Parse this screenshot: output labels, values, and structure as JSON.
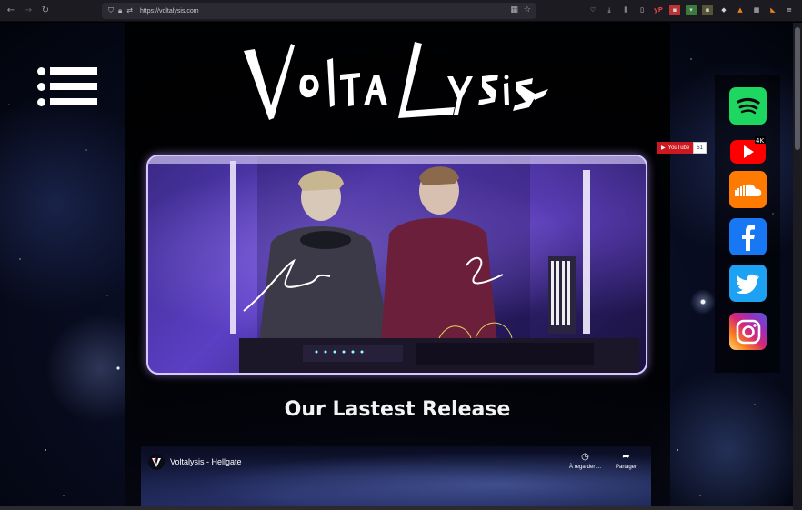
{
  "browser": {
    "url": "https://voltalysis.com",
    "back_icon": "←",
    "forward_icon": "→",
    "reload_icon": "↻",
    "toolbar_icons": [
      "pocket",
      "download",
      "library",
      "sidebar",
      "yp",
      "ext-red",
      "ext-green",
      "ext-10",
      "ext-mask",
      "ext-fox",
      "ext-grid",
      "ext-fox2",
      "menu"
    ]
  },
  "site": {
    "logo_text": "VoltaLysis",
    "release_heading": "Our Lastest Release",
    "youtube_badge": {
      "label": "YouTube",
      "count": "51"
    },
    "video": {
      "title": "Voltalysis - Hellgate",
      "watch_later": "À regarder ...",
      "share": "Partager"
    },
    "social": [
      {
        "name": "spotify",
        "color": "#1ed760"
      },
      {
        "name": "youtube",
        "color": "#ff0000"
      },
      {
        "name": "soundcloud",
        "color": "#ff7700"
      },
      {
        "name": "facebook",
        "color": "#1877f2"
      },
      {
        "name": "twitter",
        "color": "#1da1f2"
      },
      {
        "name": "instagram",
        "color": "#d6249f"
      }
    ]
  }
}
